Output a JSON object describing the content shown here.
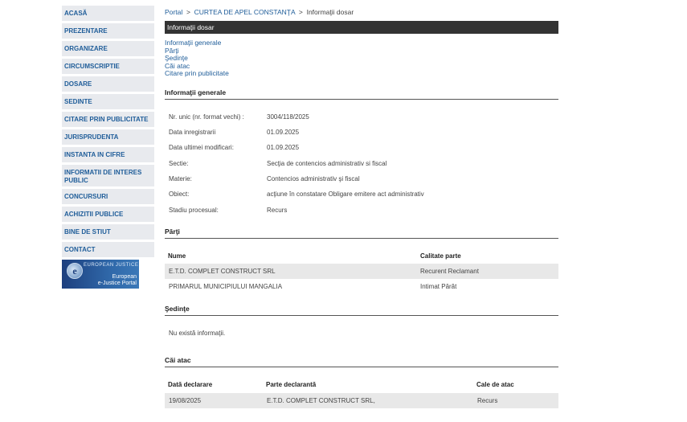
{
  "sidebar": {
    "items": [
      {
        "label": "ACASĂ"
      },
      {
        "label": "PREZENTARE"
      },
      {
        "label": "ORGANIZARE"
      },
      {
        "label": "CIRCUMSCRIPTIE"
      },
      {
        "label": "DOSARE"
      },
      {
        "label": "SEDINTE"
      },
      {
        "label": "CITARE PRIN PUBLICITATE"
      },
      {
        "label": "JURISPRUDENTA"
      },
      {
        "label": "INSTANTA IN CIFRE"
      },
      {
        "label": "INFORMATII DE INTERES PUBLIC"
      },
      {
        "label": "CONCURSURI"
      },
      {
        "label": "ACHIZITII PUBLICE"
      },
      {
        "label": "BINE DE STIUT"
      },
      {
        "label": "CONTACT"
      }
    ],
    "banner": {
      "top": "EUROPEAN JUSTICE",
      "bottom_line1": "European",
      "bottom_line2": "e-Justice Portal",
      "letter": "e"
    }
  },
  "breadcrumb": {
    "portal": "Portal",
    "sep": ">",
    "court": "CURTEA DE APEL CONSTANŢA",
    "current": "Informaţii dosar"
  },
  "title": "Informaţii dosar",
  "quick_links": [
    "Informaţii generale",
    "Părţi",
    "Şedinţe",
    "Căi atac",
    "Citare prin publicitate"
  ],
  "general": {
    "heading": "Informaţii generale",
    "rows": [
      {
        "label": "Nr. unic (nr. format vechi) :",
        "value": "3004/118/2025"
      },
      {
        "label": "Data inregistrarii",
        "value": "01.09.2025"
      },
      {
        "label": "Data ultimei modificari:",
        "value": "01.09.2025"
      },
      {
        "label": "Sectie:",
        "value": "Secţia de contencios administrativ si fiscal"
      },
      {
        "label": "Materie:",
        "value": "Contencios administrativ şi fiscal"
      },
      {
        "label": "Obiect:",
        "value": "acţiune în constatare Obligare emitere act administrativ"
      },
      {
        "label": "Stadiu procesual:",
        "value": "Recurs"
      }
    ]
  },
  "parti": {
    "heading": "Părţi",
    "columns": [
      "Nume",
      "Calitate parte"
    ],
    "rows": [
      {
        "nume": "E.T.D. COMPLET CONSTRUCT SRL",
        "calitate": "Recurent Reclamant"
      },
      {
        "nume": "PRIMARUL MUNICIPIULUI MANGALIA",
        "calitate": "Intimat Pârât"
      }
    ]
  },
  "sedinte": {
    "heading": "Şedinţe",
    "empty": "Nu există informaţii."
  },
  "cai_atac": {
    "heading": "Căi atac",
    "columns": [
      "Dată declarare",
      "Parte declarantă",
      "Cale de atac"
    ],
    "rows": [
      {
        "data": "19/08/2025",
        "parte": "E.T.D. COMPLET CONSTRUCT SRL,",
        "cale": "Recurs"
      }
    ]
  },
  "colors": {
    "link": "#1f5d99",
    "title_bar": "#333333",
    "nav_bg": "#e8eaee"
  }
}
